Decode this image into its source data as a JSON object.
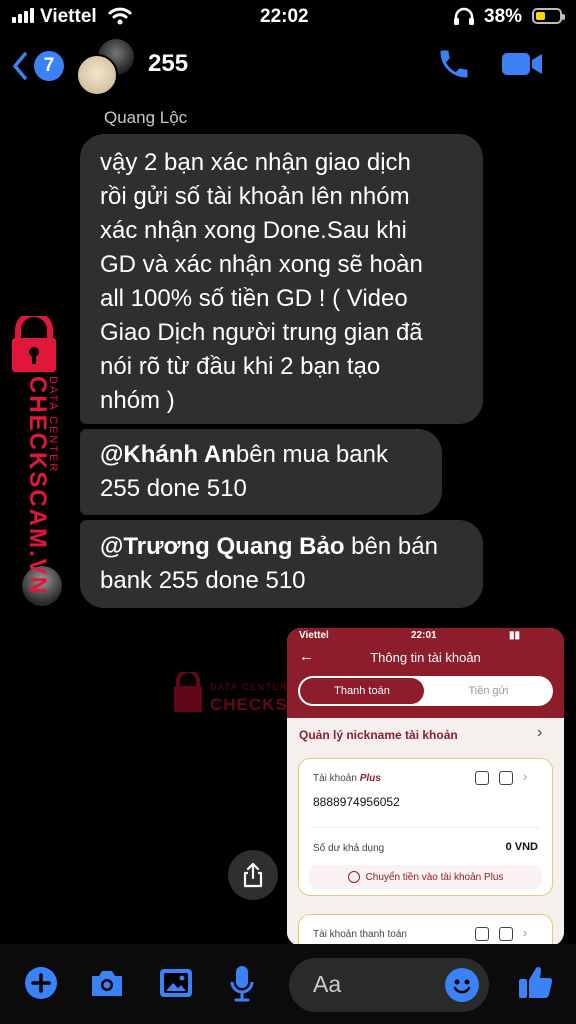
{
  "status_bar": {
    "carrier": "Viettel",
    "time": "22:02",
    "battery": "38%"
  },
  "header": {
    "back_count": "7",
    "title": "255"
  },
  "messages": {
    "sender": "Quang Lộc",
    "m1_lines": [
      "vậy 2 bạn xác nhận giao dịch",
      "rồi gửi số tài khoản lên nhóm",
      "xác nhận xong Done.Sau khi",
      "GD và xác nhận xong sẽ hoàn",
      "all 100% số tiền GD ! ( Video",
      "Giao Dịch người trung gian đã",
      "nói rõ từ đầu khi 2 bạn tạo",
      "nhóm )"
    ],
    "m2_mention": "@Khánh An",
    "m2_rest": "bên mua bank",
    "m2_line2": "255 done 510",
    "m3_mention": "@Trương Quang Bảo",
    "m3_rest": " bên bán",
    "m3_line2": "bank 255 done 510"
  },
  "watermark": {
    "top": "DATA CENTER",
    "brand": "CHECKSCAM.VN"
  },
  "photo": {
    "status_carrier": "Viettel",
    "status_time": "22:01",
    "title": "Thông tin tài khoản",
    "tab_active": "Thanh toán",
    "tab_inactive": "Tiền gửi",
    "nickname": "Quản lý nickname tài khoản",
    "account_label": "Tài khoản",
    "account_plus": "Plus",
    "account_number": "8888974956052",
    "balance_label": "Số dư khả dụng",
    "balance_value": "0 VND",
    "transfer_btn": "Chuyển tiền vào tài khoản Plus",
    "account2_label": "Tài khoản thanh toán"
  },
  "composer": {
    "placeholder": "Aa"
  },
  "colors": {
    "accent": "#3b82f6",
    "bubble": "#2f2f2f",
    "bank": "#8e1d2c",
    "watermark": "#e0173b"
  }
}
